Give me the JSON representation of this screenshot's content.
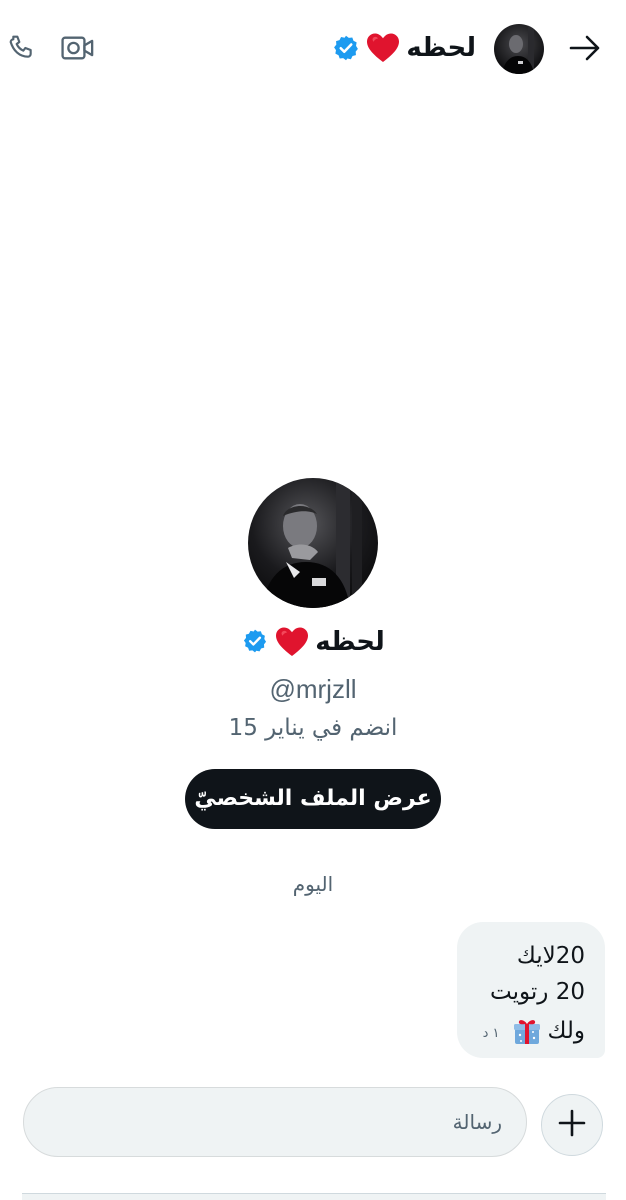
{
  "header": {
    "name": "لحظه",
    "name_emoji": "heart-icon",
    "verified": true,
    "icons": [
      "phone-icon",
      "video-icon",
      "arrow-right-icon"
    ]
  },
  "profile": {
    "name": "لحظه",
    "handle": "@mrjzll",
    "joined": "انضم في يناير 15",
    "view_profile_label": "عرض الملف الشخصيّ"
  },
  "chat": {
    "date_separator": "اليوم",
    "messages": [
      {
        "lines": [
          "20لايك",
          "20 رتويت",
          "ولك"
        ],
        "emoji": "gift-icon",
        "time": "١ د"
      }
    ]
  },
  "composer": {
    "placeholder": "رسالة"
  },
  "colors": {
    "accent": "#1d9bf0",
    "heart": "#e0142e",
    "text": "#0f1419",
    "muted": "#536471",
    "bubble": "#eff3f4"
  }
}
